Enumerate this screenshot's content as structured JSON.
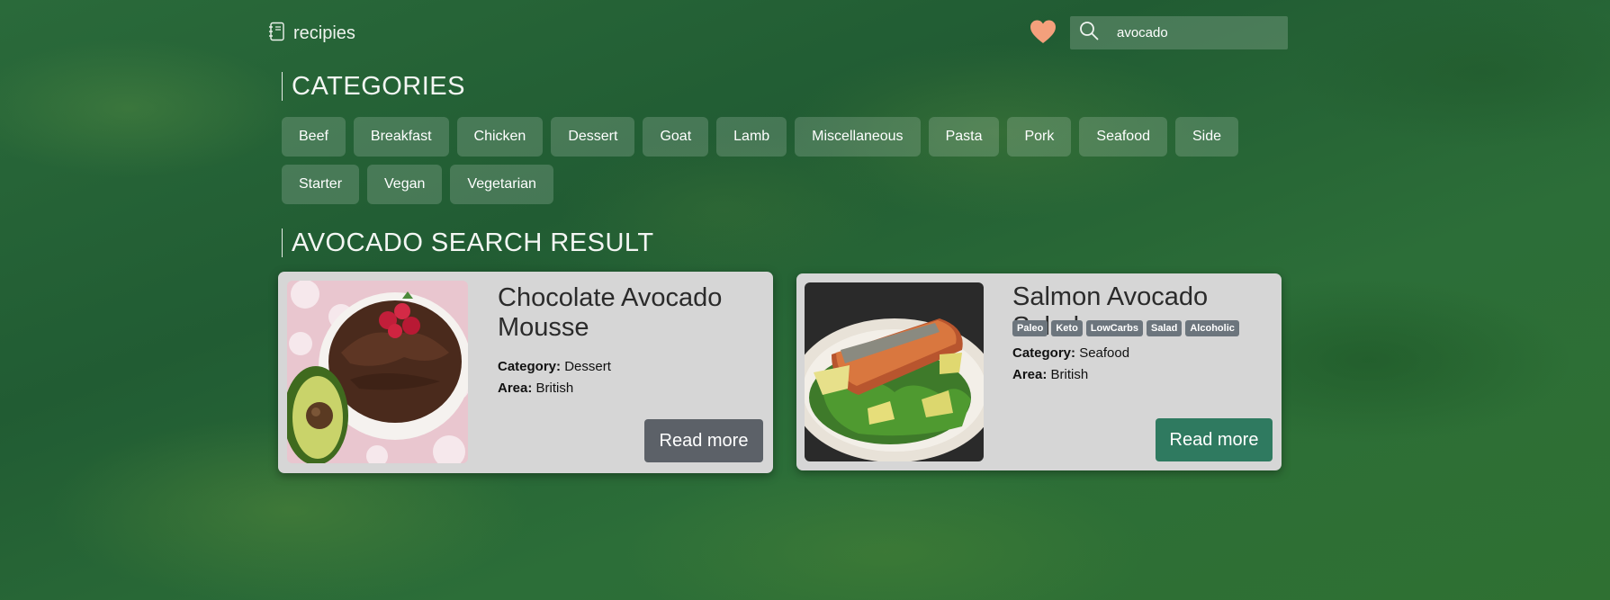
{
  "header": {
    "logo_text": "recipies",
    "search": {
      "value": "avocado",
      "placeholder": ""
    }
  },
  "categories": {
    "title": "CATEGORIES",
    "rows": [
      [
        "Beef",
        "Breakfast",
        "Chicken",
        "Dessert",
        "Goat",
        "Lamb",
        "Miscellaneous",
        "Pasta",
        "Pork",
        "Seafood",
        "Side"
      ],
      [
        "Starter",
        "Vegan",
        "Vegetarian"
      ]
    ]
  },
  "results": {
    "title": "AVOCADO SEARCH RESULT",
    "cards": [
      {
        "title": "Chocolate Avocado Mousse",
        "tags": [],
        "category_label": "Category:",
        "category": "Dessert",
        "area_label": "Area:",
        "area": "British",
        "button": "Read more"
      },
      {
        "title": "Salmon Avocado Salad",
        "tags": [
          "Paleo",
          "Keto",
          "LowCarbs",
          "Salad",
          "Alcoholic"
        ],
        "category_label": "Category:",
        "category": "Seafood",
        "area_label": "Area:",
        "area": "British",
        "button": "Read more"
      }
    ]
  },
  "colors": {
    "heart": "#f4a07c",
    "read_more_gray": "#5c6168",
    "read_more_green": "#2f7a60",
    "card_bg": "#d6d6d6",
    "tag_bg": "#6c757d"
  },
  "icons": {
    "logo": "recipe-book-icon",
    "favorites": "heart-icon",
    "search": "search-icon"
  }
}
